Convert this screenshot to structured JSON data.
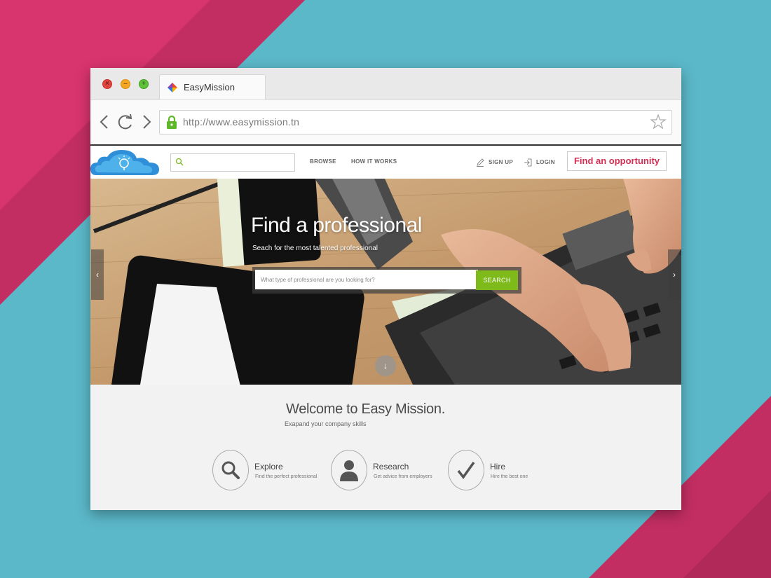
{
  "browser": {
    "tab_title": "EasyMission",
    "url": "http://www.easymission.tn"
  },
  "site": {
    "search_placeholder": "",
    "nav": {
      "browse": "BROWSE",
      "how_it_works": "HOW IT WORKS",
      "sign_up": "SIGN UP",
      "login": "LOGIN",
      "cta": "Find an opportunity"
    },
    "hero": {
      "title": "Find a professional",
      "subtitle": "Seach for the most talented professional",
      "search_placeholder": "What type of professional are you looking for?",
      "search_button": "SEARCH"
    },
    "welcome": {
      "title": "Welcome to Easy Mission.",
      "subtitle": "Exapand your company skills",
      "features": [
        {
          "title": "Explore",
          "subtitle": "Find the perfect professional",
          "icon": "search-icon"
        },
        {
          "title": "Research",
          "subtitle": "Get advice from employers",
          "icon": "person-icon"
        },
        {
          "title": "Hire",
          "subtitle": "Hire the best one",
          "icon": "checkmark-icon"
        }
      ]
    }
  },
  "colors": {
    "accent_red": "#d42d52",
    "accent_green": "#7dba1a",
    "bg_pink": "#d63a6e",
    "bg_teal": "#5bb8c9"
  }
}
